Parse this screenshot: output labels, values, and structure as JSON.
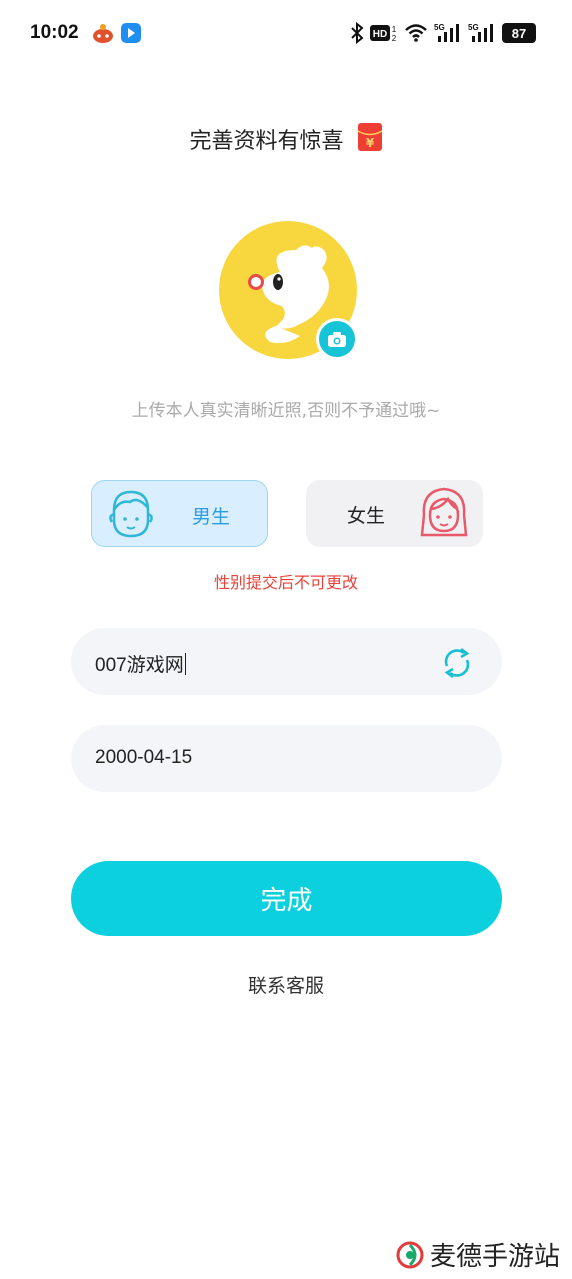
{
  "status_bar": {
    "time": "10:02",
    "battery": "87",
    "icons": [
      "app-notification-icon",
      "blue-app-icon",
      "bluetooth-icon",
      "hd-icon",
      "wifi-icon",
      "signal-5g-icon",
      "signal-5g-icon"
    ]
  },
  "header": {
    "title": "完善资料有惊喜",
    "title_icon": "red-packet-icon"
  },
  "avatar": {
    "icon": "squirrel-avatar",
    "camera_icon": "camera-icon",
    "hint": "上传本人真实清晰近照,否则不予通过哦~"
  },
  "gender": {
    "male_label": "男生",
    "female_label": "女生",
    "selected": "male",
    "warning": "性别提交后不可更改"
  },
  "form": {
    "nickname_value": "007游戏网",
    "birthday_value": "2000-04-15"
  },
  "actions": {
    "submit_label": "完成",
    "contact_label": "联系客服"
  },
  "watermark": {
    "text": "麦德手游站"
  },
  "colors": {
    "accent": "#0dd0de",
    "male_selected_bg": "#d9efff",
    "male_text": "#2d9be0",
    "warning": "#e8433a",
    "avatar_yellow": "#f8d63e"
  }
}
